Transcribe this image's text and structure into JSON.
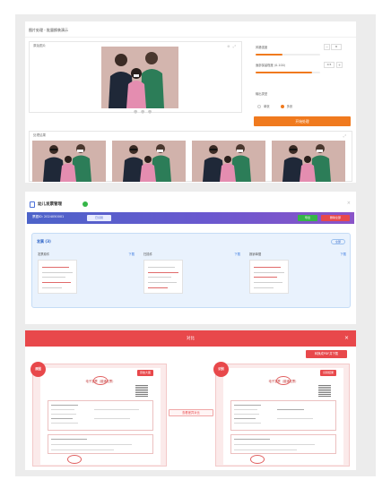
{
  "colors": {
    "accent_orange": "#f07a1e",
    "accent_blue": "#4c63c9",
    "accent_red": "#e8484b",
    "accent_green": "#35b648"
  },
  "panel_photo": {
    "title": "图片处理 - 批量换装演示",
    "original_label": "原始图片",
    "tools": "⊕ ⤢",
    "settings": {
      "label_1": "风格强度",
      "value_1": "8",
      "level_1": 0.42,
      "label_2": "面部保留程度 (0-100)",
      "value_2": "0.5",
      "level_2": 0.88,
      "label_3": "输出类型",
      "option_a": "单张",
      "option_b": "多张",
      "selected": "多张"
    },
    "run_button": "开始处理",
    "result_label": "处理结果",
    "result_count": 4
  },
  "panel_docs": {
    "title": "幼儿发票管理",
    "bar_text": "票据ID: 2024050001",
    "bar_tag": "已识别",
    "bar_btn_1": "导出",
    "bar_btn_2": "删除全部",
    "card_title": "发票 (3)",
    "card_button": "全部",
    "files": [
      {
        "name": "发票原件",
        "download": "下载"
      },
      {
        "name": "扫描件",
        "download": "下载"
      },
      {
        "name": "报销单据",
        "download": "下载"
      }
    ]
  },
  "panel_compare": {
    "title": "对比",
    "close": "×",
    "action_button": "转换成PDF并下载",
    "mid_button": "查看差异对比",
    "left_badge": "原图",
    "right_badge": "识别",
    "left_chip": "原始大图",
    "right_chip": "识别结果",
    "doc_title": "电子发票（普通发票）"
  }
}
